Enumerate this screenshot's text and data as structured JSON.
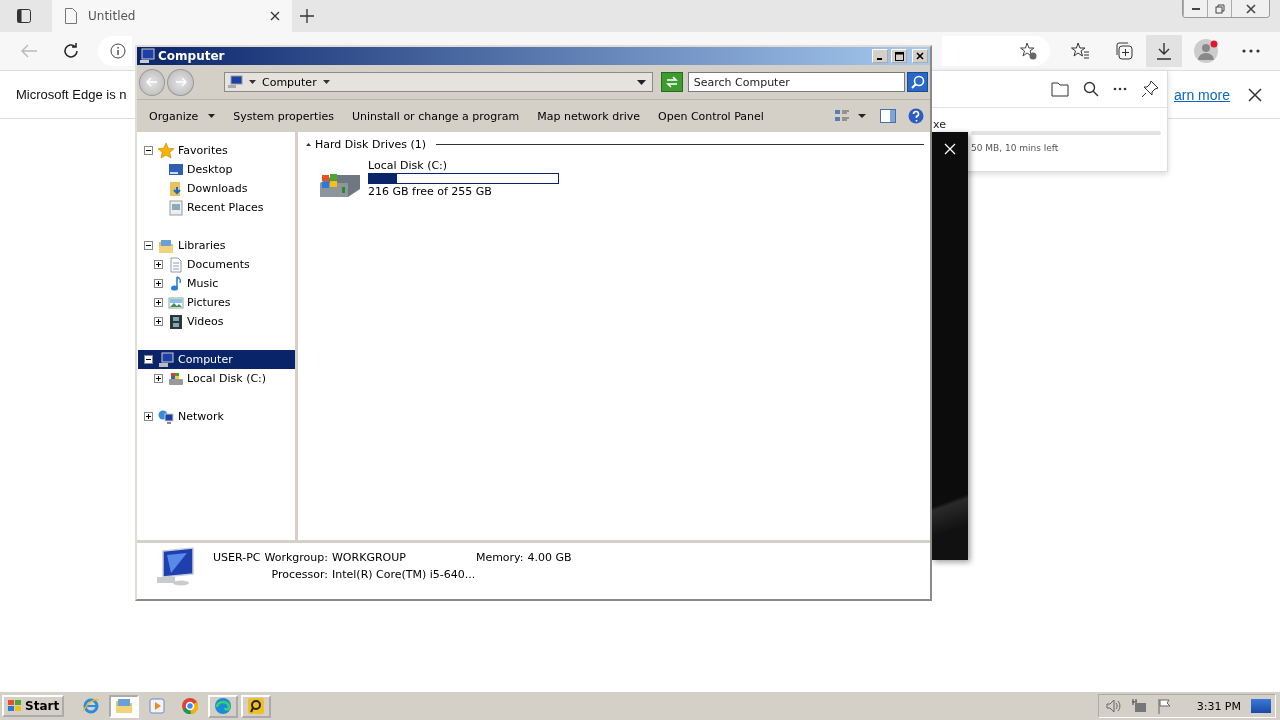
{
  "browser": {
    "tab": {
      "title": "Untitled"
    },
    "infobar": {
      "message": "Microsoft Edge is n",
      "link": "arn more"
    },
    "downloads_panel": {
      "file_name": "xe",
      "status": "50 MB, 10 mins left"
    }
  },
  "explorer": {
    "title": "Computer",
    "address": "Computer",
    "search": {
      "placeholder": "Search Computer"
    },
    "toolbar": [
      {
        "label": "Organize",
        "kind": "menu"
      },
      {
        "label": "System properties",
        "kind": "button"
      },
      {
        "label": "Uninstall or change a program",
        "kind": "button"
      },
      {
        "label": "Map network drive",
        "kind": "button"
      },
      {
        "label": "Open Control Panel",
        "kind": "button"
      }
    ],
    "nav": [
      {
        "label": "Favorites",
        "expanded": true,
        "selected": false,
        "children": [
          {
            "label": "Desktop",
            "selected": false
          },
          {
            "label": "Downloads",
            "selected": false
          },
          {
            "label": "Recent Places",
            "selected": false
          }
        ]
      },
      {
        "label": "Libraries",
        "expanded": true,
        "selected": false,
        "children": [
          {
            "label": "Documents",
            "expanded": false,
            "selected": false
          },
          {
            "label": "Music",
            "expanded": false,
            "selected": false
          },
          {
            "label": "Pictures",
            "expanded": false,
            "selected": false
          },
          {
            "label": "Videos",
            "expanded": false,
            "selected": false
          }
        ]
      },
      {
        "label": "Computer",
        "expanded": true,
        "selected": true,
        "children": [
          {
            "label": "Local Disk (C:)",
            "expanded": false,
            "selected": false
          }
        ]
      },
      {
        "label": "Network",
        "expanded": false,
        "selected": false
      }
    ],
    "group": {
      "title": "Hard Disk Drives (1)"
    },
    "drives": [
      {
        "name": "Local Disk (C:)",
        "level": 0.15,
        "free": "216 GB free of 255 GB"
      }
    ],
    "details": {
      "name": "USER-PC",
      "workgroup_label": "Workgroup:",
      "workgroup": "WORKGROUP",
      "memory_label": "Memory:",
      "memory": "4.00 GB",
      "processor_label": "Processor:",
      "processor": "Intel(R) Core(TM) i5-640..."
    }
  },
  "taskbar": {
    "start": "Start",
    "apps": [
      {
        "kind": "ie",
        "running": false,
        "selected": false
      },
      {
        "kind": "explorer",
        "running": true,
        "selected": true
      },
      {
        "kind": "media",
        "running": false,
        "selected": false
      },
      {
        "kind": "chrome",
        "running": false,
        "selected": false
      },
      {
        "kind": "edge",
        "running": true,
        "selected": false
      },
      {
        "kind": "app",
        "running": true,
        "selected": false
      }
    ],
    "clock": "3:31 PM"
  }
}
